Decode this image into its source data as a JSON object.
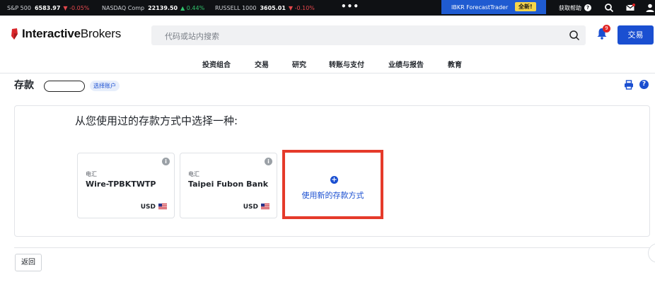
{
  "ticker": [
    {
      "name": "S&P 500",
      "value": "6583.97",
      "change": "▼ -0.05%",
      "dir": "down"
    },
    {
      "name": "NASDAQ Comp",
      "value": "22139.50",
      "change": "▲ 0.44%",
      "dir": "up"
    },
    {
      "name": "RUSSELL 1000",
      "value": "3605.01",
      "change": "▼ -0.10%",
      "dir": "down"
    }
  ],
  "topbar": {
    "more": "•••",
    "forecast_label": "IBKR ForecastTrader",
    "forecast_badge": "全新!",
    "help_label": "获取帮助"
  },
  "header": {
    "logo_bold": "Interactive",
    "logo_rest": "Brokers",
    "search_placeholder": "代码或站内搜索",
    "notification_count": "9",
    "trade_button": "交易"
  },
  "nav": [
    "投资组合",
    "交易",
    "研究",
    "转账与支付",
    "业绩与报告",
    "教育"
  ],
  "page": {
    "title": "存款",
    "choose_account": "选择账户",
    "heading": "从您使用过的存款方式中选择一种:",
    "back_button": "返回"
  },
  "methods": [
    {
      "type": "电汇",
      "name": "Wire-TPBKTWTP",
      "currency": "USD"
    },
    {
      "type": "电汇",
      "name": "Taipei Fubon Bank",
      "currency": "USD"
    }
  ],
  "new_method": {
    "label": "使用新的存款方式"
  },
  "colors": {
    "accent": "#1a4fd1",
    "highlight": "#e53a2a",
    "ticker_bg": "#0f1114"
  }
}
